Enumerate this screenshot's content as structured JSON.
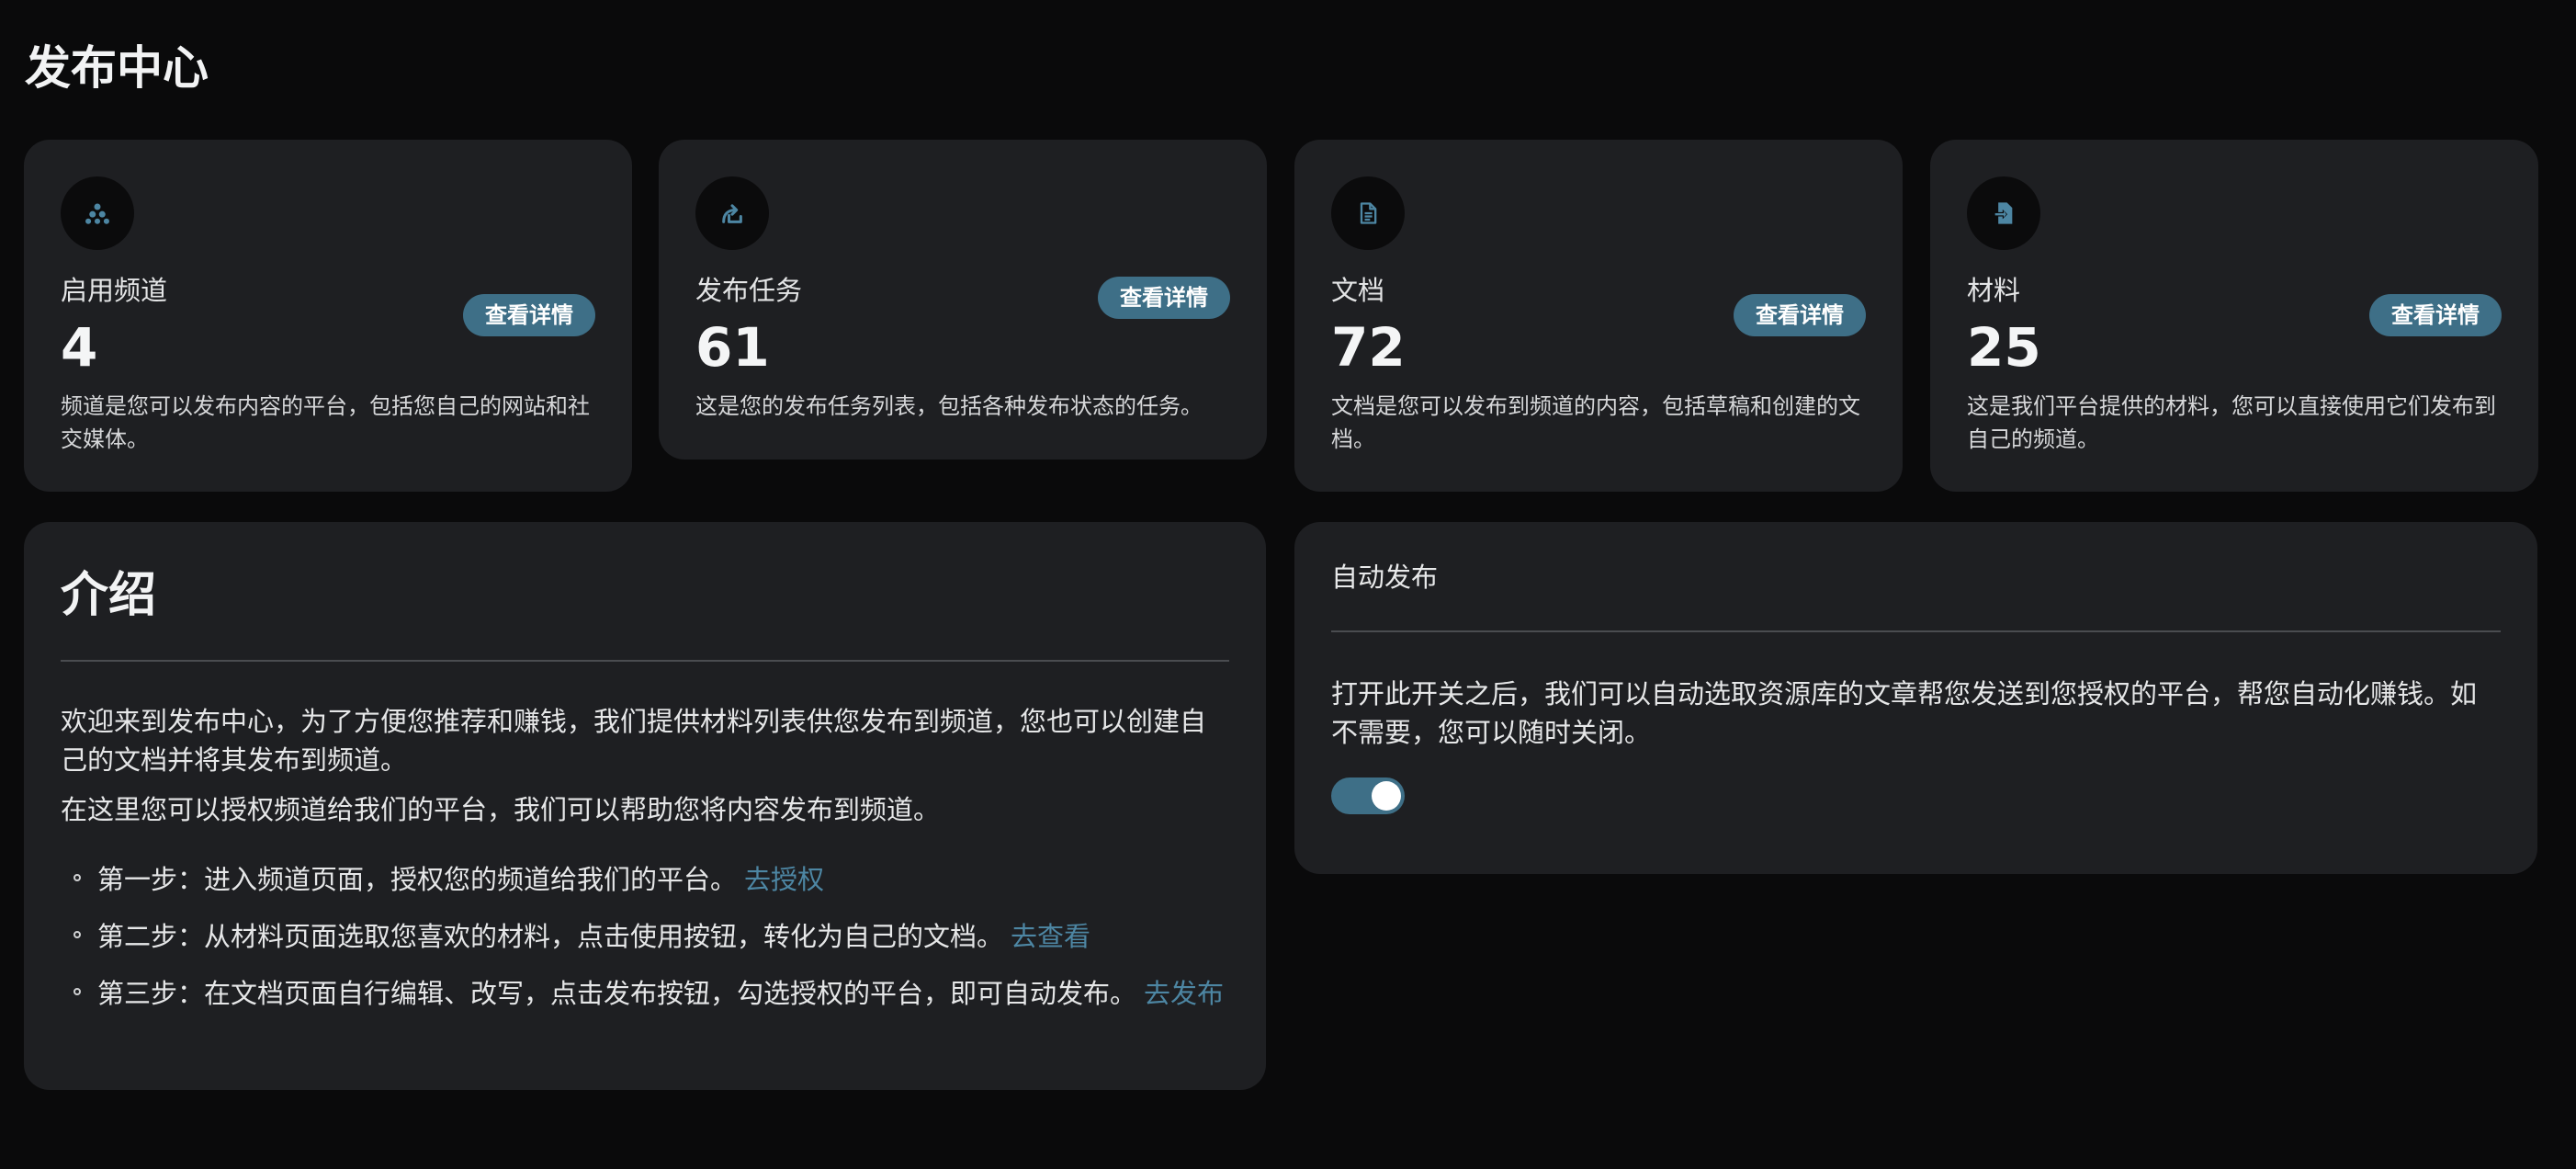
{
  "header": {
    "title": "发布中心"
  },
  "stats": [
    {
      "icon": "sitemap-icon",
      "label": "启用频道",
      "value": "4",
      "desc": "频道是您可以发布内容的平台，包括您自己的网站和社交媒体。",
      "button": "查看详情"
    },
    {
      "icon": "share-arrow-icon",
      "label": "发布任务",
      "value": "61",
      "desc": "这是您的发布任务列表，包括各种发布状态的任务。",
      "button": "查看详情"
    },
    {
      "icon": "document-icon",
      "label": "文档",
      "value": "72",
      "desc": "文档是您可以发布到频道的内容，包括草稿和创建的文档。",
      "button": "查看详情"
    },
    {
      "icon": "file-import-icon",
      "label": "材料",
      "value": "25",
      "desc": "这是我们平台提供的材料，您可以直接使用它们发布到自己的频道。",
      "button": "查看详情"
    }
  ],
  "intro": {
    "title": "介绍",
    "p1": "欢迎来到发布中心，为了方便您推荐和赚钱，我们提供材料列表供您发布到频道，您也可以创建自己的文档并将其发布到频道。",
    "p2": "在这里您可以授权频道给我们的平台，我们可以帮助您将内容发布到频道。",
    "steps": [
      {
        "text": "第一步：进入频道页面，授权您的频道给我们的平台。",
        "link": "去授权"
      },
      {
        "text": "第二步：从材料页面选取您喜欢的材料，点击使用按钮，转化为自己的文档。",
        "link": "去查看"
      },
      {
        "text": "第三步：在文档页面自行编辑、改写，点击发布按钮，勾选授权的平台，即可自动发布。",
        "link": "去发布"
      }
    ]
  },
  "auto_publish": {
    "title": "自动发布",
    "desc": "打开此开关之后，我们可以自动选取资源库的文章帮您发送到您授权的平台，帮您自动化赚钱。如不需要，您可以随时关闭。",
    "enabled": true
  },
  "colors": {
    "background": "#0a0a0b",
    "card": "#1e1f22",
    "accent": "#3e6f87",
    "link": "#4d86a3"
  }
}
